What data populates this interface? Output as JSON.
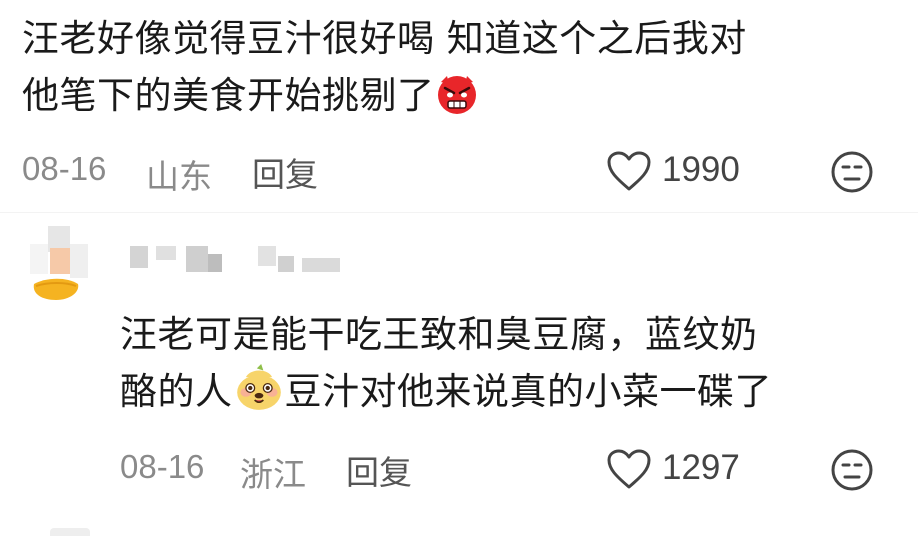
{
  "comment": {
    "text_line1": "汪老好像觉得豆汁很好喝 知道这个之后我对",
    "text_line2": "他笔下的美食开始挑剔了",
    "emoji": "angry-face-icon",
    "date": "08-16",
    "location": "山东",
    "reply_label": "回复",
    "likes": "1990"
  },
  "reply": {
    "text_line1": "汪老可是能干吃王致和臭豆腐，蓝纹奶",
    "text_line2_a": "酪的人",
    "emoji": "dog-face-icon",
    "text_line2_b": "豆汁对他来说真的小菜一碟了",
    "date": "08-16",
    "location": "浙江",
    "reply_label": "回复",
    "likes": "1297"
  },
  "colors": {
    "text": "#1a1a1a",
    "meta": "#8a8a8a",
    "icon": "#444444"
  }
}
